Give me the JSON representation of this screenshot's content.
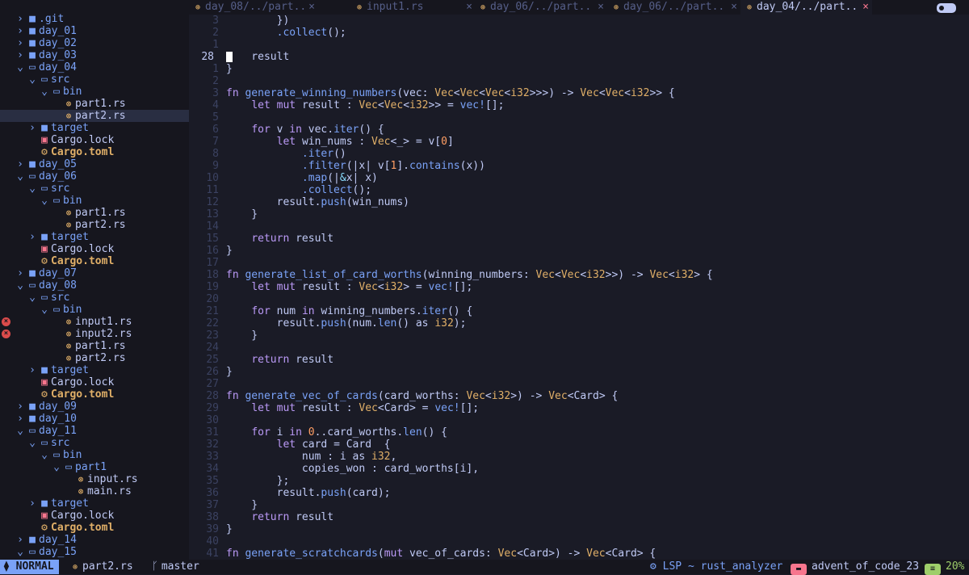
{
  "sidebar": {
    "items": [
      {
        "depth": 0,
        "kind": "dir",
        "open": false,
        "label": ".git"
      },
      {
        "depth": 0,
        "kind": "dir",
        "open": false,
        "label": "day_01"
      },
      {
        "depth": 0,
        "kind": "dir",
        "open": false,
        "label": "day_02"
      },
      {
        "depth": 0,
        "kind": "dir",
        "open": false,
        "label": "day_03"
      },
      {
        "depth": 0,
        "kind": "dir",
        "open": true,
        "label": "day_04"
      },
      {
        "depth": 1,
        "kind": "dir",
        "open": true,
        "label": "src"
      },
      {
        "depth": 2,
        "kind": "dir",
        "open": true,
        "label": "bin"
      },
      {
        "depth": 3,
        "kind": "rs",
        "label": "part1.rs"
      },
      {
        "depth": 3,
        "kind": "rs",
        "label": "part2.rs",
        "selected": true
      },
      {
        "depth": 1,
        "kind": "dir",
        "open": false,
        "label": "target"
      },
      {
        "depth": 1,
        "kind": "lock",
        "label": "Cargo.lock"
      },
      {
        "depth": 1,
        "kind": "toml",
        "label": "Cargo.toml"
      },
      {
        "depth": 0,
        "kind": "dir",
        "open": false,
        "label": "day_05"
      },
      {
        "depth": 0,
        "kind": "dir",
        "open": true,
        "label": "day_06"
      },
      {
        "depth": 1,
        "kind": "dir",
        "open": true,
        "label": "src"
      },
      {
        "depth": 2,
        "kind": "dir",
        "open": true,
        "label": "bin"
      },
      {
        "depth": 3,
        "kind": "rs",
        "label": "part1.rs"
      },
      {
        "depth": 3,
        "kind": "rs",
        "label": "part2.rs"
      },
      {
        "depth": 1,
        "kind": "dir",
        "open": false,
        "label": "target"
      },
      {
        "depth": 1,
        "kind": "lock",
        "label": "Cargo.lock"
      },
      {
        "depth": 1,
        "kind": "toml",
        "label": "Cargo.toml"
      },
      {
        "depth": 0,
        "kind": "dir",
        "open": false,
        "label": "day_07"
      },
      {
        "depth": 0,
        "kind": "dir",
        "open": true,
        "label": "day_08"
      },
      {
        "depth": 1,
        "kind": "dir",
        "open": true,
        "label": "src"
      },
      {
        "depth": 2,
        "kind": "dir",
        "open": true,
        "label": "bin"
      },
      {
        "depth": 3,
        "kind": "rs",
        "label": "input1.rs",
        "error": true
      },
      {
        "depth": 3,
        "kind": "rs",
        "label": "input2.rs",
        "error": true
      },
      {
        "depth": 3,
        "kind": "rs",
        "label": "part1.rs"
      },
      {
        "depth": 3,
        "kind": "rs",
        "label": "part2.rs"
      },
      {
        "depth": 1,
        "kind": "dir",
        "open": false,
        "label": "target"
      },
      {
        "depth": 1,
        "kind": "lock",
        "label": "Cargo.lock"
      },
      {
        "depth": 1,
        "kind": "toml",
        "label": "Cargo.toml"
      },
      {
        "depth": 0,
        "kind": "dir",
        "open": false,
        "label": "day_09"
      },
      {
        "depth": 0,
        "kind": "dir",
        "open": false,
        "label": "day_10"
      },
      {
        "depth": 0,
        "kind": "dir",
        "open": true,
        "label": "day_11"
      },
      {
        "depth": 1,
        "kind": "dir",
        "open": true,
        "label": "src"
      },
      {
        "depth": 2,
        "kind": "dir",
        "open": true,
        "label": "bin"
      },
      {
        "depth": 3,
        "kind": "dir",
        "open": true,
        "label": "part1"
      },
      {
        "depth": 4,
        "kind": "rs",
        "label": "input.rs"
      },
      {
        "depth": 4,
        "kind": "rs",
        "label": "main.rs"
      },
      {
        "depth": 1,
        "kind": "dir",
        "open": false,
        "label": "target"
      },
      {
        "depth": 1,
        "kind": "lock",
        "label": "Cargo.lock"
      },
      {
        "depth": 1,
        "kind": "toml",
        "label": "Cargo.toml"
      },
      {
        "depth": 0,
        "kind": "dir",
        "open": false,
        "label": "day_14"
      },
      {
        "depth": 0,
        "kind": "dir",
        "open": true,
        "label": "day_15"
      }
    ]
  },
  "tabs": [
    {
      "label": "day_08/../part..",
      "active": false
    },
    {
      "label": "input1.rs",
      "active": false
    },
    {
      "label": "day_06/../part..",
      "active": false
    },
    {
      "label": "day_06/../part..",
      "active": false
    },
    {
      "label": "day_04/../part..",
      "active": true
    }
  ],
  "editor": {
    "lines": [
      {
        "n": "3",
        "t": [
          [
            "pl",
            "        })"
          ]
        ]
      },
      {
        "n": "2",
        "t": [
          [
            "pl",
            "        "
          ],
          [
            "mc",
            ".collect"
          ],
          [
            "pl",
            "();"
          ]
        ]
      },
      {
        "n": "1",
        "t": []
      },
      {
        "n": "28",
        "current": true,
        "t": [
          [
            "pl",
            "    result"
          ]
        ]
      },
      {
        "n": "1",
        "t": [
          [
            "pl",
            "}"
          ]
        ]
      },
      {
        "n": "2",
        "t": []
      },
      {
        "n": "3",
        "t": [
          [
            "kw",
            "fn "
          ],
          [
            "fn",
            "generate_winning_numbers"
          ],
          [
            "pl",
            "(vec: "
          ],
          [
            "ty",
            "Vec"
          ],
          [
            "pl",
            "<"
          ],
          [
            "ty",
            "Vec"
          ],
          [
            "pl",
            "<"
          ],
          [
            "ty",
            "Vec"
          ],
          [
            "pl",
            "<"
          ],
          [
            "ty",
            "i32"
          ],
          [
            "pl",
            ">>>) -> "
          ],
          [
            "ty",
            "Vec"
          ],
          [
            "pl",
            "<"
          ],
          [
            "ty",
            "Vec"
          ],
          [
            "pl",
            "<"
          ],
          [
            "ty",
            "i32"
          ],
          [
            "pl",
            ">> {"
          ]
        ]
      },
      {
        "n": "4",
        "t": [
          [
            "pl",
            "    "
          ],
          [
            "kw",
            "let mut "
          ],
          [
            "pl",
            "result : "
          ],
          [
            "ty",
            "Vec"
          ],
          [
            "pl",
            "<"
          ],
          [
            "ty",
            "Vec"
          ],
          [
            "pl",
            "<"
          ],
          [
            "ty",
            "i32"
          ],
          [
            "pl",
            ">> = "
          ],
          [
            "mc",
            "vec!"
          ],
          [
            "pl",
            "[];"
          ]
        ]
      },
      {
        "n": "5",
        "t": []
      },
      {
        "n": "6",
        "t": [
          [
            "pl",
            "    "
          ],
          [
            "kw",
            "for "
          ],
          [
            "pl",
            "v "
          ],
          [
            "kw",
            "in "
          ],
          [
            "pl",
            "vec."
          ],
          [
            "mc",
            "iter"
          ],
          [
            "pl",
            "() {"
          ]
        ]
      },
      {
        "n": "7",
        "t": [
          [
            "pl",
            "        "
          ],
          [
            "kw",
            "let "
          ],
          [
            "pl",
            "win_nums : "
          ],
          [
            "ty",
            "Vec"
          ],
          [
            "pl",
            "<_> = v["
          ],
          [
            "num",
            "0"
          ],
          [
            "pl",
            "]"
          ]
        ]
      },
      {
        "n": "8",
        "t": [
          [
            "pl",
            "            "
          ],
          [
            "mc",
            ".iter"
          ],
          [
            "pl",
            "()"
          ]
        ]
      },
      {
        "n": "9",
        "t": [
          [
            "pl",
            "            "
          ],
          [
            "mc",
            ".filter"
          ],
          [
            "pl",
            "(|x| v["
          ],
          [
            "num",
            "1"
          ],
          [
            "pl",
            "]."
          ],
          [
            "mc",
            "contains"
          ],
          [
            "pl",
            "(x))"
          ]
        ]
      },
      {
        "n": "10",
        "t": [
          [
            "pl",
            "            "
          ],
          [
            "mc",
            ".map"
          ],
          [
            "pl",
            "(|"
          ],
          [
            "op",
            "&"
          ],
          [
            "pl",
            "x| x)"
          ]
        ]
      },
      {
        "n": "11",
        "t": [
          [
            "pl",
            "            "
          ],
          [
            "mc",
            ".collect"
          ],
          [
            "pl",
            "();"
          ]
        ]
      },
      {
        "n": "12",
        "t": [
          [
            "pl",
            "        result."
          ],
          [
            "mc",
            "push"
          ],
          [
            "pl",
            "(win_nums)"
          ]
        ]
      },
      {
        "n": "13",
        "t": [
          [
            "pl",
            "    }"
          ]
        ]
      },
      {
        "n": "14",
        "t": []
      },
      {
        "n": "15",
        "t": [
          [
            "pl",
            "    "
          ],
          [
            "kw",
            "return "
          ],
          [
            "pl",
            "result"
          ]
        ]
      },
      {
        "n": "16",
        "t": [
          [
            "pl",
            "}"
          ]
        ]
      },
      {
        "n": "17",
        "t": []
      },
      {
        "n": "18",
        "t": [
          [
            "kw",
            "fn "
          ],
          [
            "fn",
            "generate_list_of_card_worths"
          ],
          [
            "pl",
            "(winning_numbers: "
          ],
          [
            "ty",
            "Vec"
          ],
          [
            "pl",
            "<"
          ],
          [
            "ty",
            "Vec"
          ],
          [
            "pl",
            "<"
          ],
          [
            "ty",
            "i32"
          ],
          [
            "pl",
            ">>) -> "
          ],
          [
            "ty",
            "Vec"
          ],
          [
            "pl",
            "<"
          ],
          [
            "ty",
            "i32"
          ],
          [
            "pl",
            "> {"
          ]
        ]
      },
      {
        "n": "19",
        "t": [
          [
            "pl",
            "    "
          ],
          [
            "kw",
            "let mut "
          ],
          [
            "pl",
            "result : "
          ],
          [
            "ty",
            "Vec"
          ],
          [
            "pl",
            "<"
          ],
          [
            "ty",
            "i32"
          ],
          [
            "pl",
            "> = "
          ],
          [
            "mc",
            "vec!"
          ],
          [
            "pl",
            "[];"
          ]
        ]
      },
      {
        "n": "20",
        "t": []
      },
      {
        "n": "21",
        "t": [
          [
            "pl",
            "    "
          ],
          [
            "kw",
            "for "
          ],
          [
            "pl",
            "num "
          ],
          [
            "kw",
            "in "
          ],
          [
            "pl",
            "winning_numbers."
          ],
          [
            "mc",
            "iter"
          ],
          [
            "pl",
            "() {"
          ]
        ]
      },
      {
        "n": "22",
        "t": [
          [
            "pl",
            "        result."
          ],
          [
            "mc",
            "push"
          ],
          [
            "pl",
            "(num."
          ],
          [
            "mc",
            "len"
          ],
          [
            "pl",
            "() as "
          ],
          [
            "ty",
            "i32"
          ],
          [
            "pl",
            ");"
          ]
        ]
      },
      {
        "n": "23",
        "t": [
          [
            "pl",
            "    }"
          ]
        ]
      },
      {
        "n": "24",
        "t": []
      },
      {
        "n": "25",
        "t": [
          [
            "pl",
            "    "
          ],
          [
            "kw",
            "return "
          ],
          [
            "pl",
            "result"
          ]
        ]
      },
      {
        "n": "26",
        "t": [
          [
            "pl",
            "}"
          ]
        ]
      },
      {
        "n": "27",
        "t": []
      },
      {
        "n": "28",
        "t": [
          [
            "kw",
            "fn "
          ],
          [
            "fn",
            "generate_vec_of_cards"
          ],
          [
            "pl",
            "(card_worths: "
          ],
          [
            "ty",
            "Vec"
          ],
          [
            "pl",
            "<"
          ],
          [
            "ty",
            "i32"
          ],
          [
            "pl",
            ">) -> "
          ],
          [
            "ty",
            "Vec"
          ],
          [
            "pl",
            "<Card> {"
          ]
        ]
      },
      {
        "n": "29",
        "t": [
          [
            "pl",
            "    "
          ],
          [
            "kw",
            "let mut "
          ],
          [
            "pl",
            "result : "
          ],
          [
            "ty",
            "Vec"
          ],
          [
            "pl",
            "<Card> = "
          ],
          [
            "mc",
            "vec!"
          ],
          [
            "pl",
            "[];"
          ]
        ]
      },
      {
        "n": "30",
        "t": []
      },
      {
        "n": "31",
        "t": [
          [
            "pl",
            "    "
          ],
          [
            "kw",
            "for "
          ],
          [
            "pl",
            "i "
          ],
          [
            "kw",
            "in "
          ],
          [
            "num",
            "0"
          ],
          [
            "pl",
            "..card_worths."
          ],
          [
            "mc",
            "len"
          ],
          [
            "pl",
            "() {"
          ]
        ]
      },
      {
        "n": "32",
        "t": [
          [
            "pl",
            "        "
          ],
          [
            "kw",
            "let "
          ],
          [
            "pl",
            "card = Card  {"
          ]
        ]
      },
      {
        "n": "33",
        "t": [
          [
            "pl",
            "            num : i as "
          ],
          [
            "ty",
            "i32"
          ],
          [
            "pl",
            ","
          ]
        ]
      },
      {
        "n": "34",
        "t": [
          [
            "pl",
            "            copies_won : card_worths[i],"
          ]
        ]
      },
      {
        "n": "35",
        "t": [
          [
            "pl",
            "        };"
          ]
        ]
      },
      {
        "n": "36",
        "t": [
          [
            "pl",
            "        result."
          ],
          [
            "mc",
            "push"
          ],
          [
            "pl",
            "(card);"
          ]
        ]
      },
      {
        "n": "37",
        "t": [
          [
            "pl",
            "    }"
          ]
        ]
      },
      {
        "n": "38",
        "t": [
          [
            "pl",
            "    "
          ],
          [
            "kw",
            "return "
          ],
          [
            "pl",
            "result"
          ]
        ]
      },
      {
        "n": "39",
        "t": [
          [
            "pl",
            "}"
          ]
        ]
      },
      {
        "n": "40",
        "t": []
      },
      {
        "n": "41",
        "t": [
          [
            "kw",
            "fn "
          ],
          [
            "fn",
            "generate_scratchcards"
          ],
          [
            "pl",
            "("
          ],
          [
            "kw",
            "mut "
          ],
          [
            "pl",
            "vec_of_cards: "
          ],
          [
            "ty",
            "Vec"
          ],
          [
            "pl",
            "<Card>) -> "
          ],
          [
            "ty",
            "Vec"
          ],
          [
            "pl",
            "<Card> {"
          ]
        ]
      }
    ]
  },
  "status": {
    "mode": "NORMAL",
    "file": "part2.rs",
    "branch": "master",
    "lsp": "LSP ~ rust_analyzer",
    "project": "advent_of_code_23",
    "percent": "20%"
  },
  "colors": {
    "background": "#1a1b26",
    "sidebar_bg": "#16161e",
    "accent_blue": "#7aa2f7",
    "keyword": "#bb9af7",
    "type": "#e0af68",
    "error": "#db4b4b"
  }
}
